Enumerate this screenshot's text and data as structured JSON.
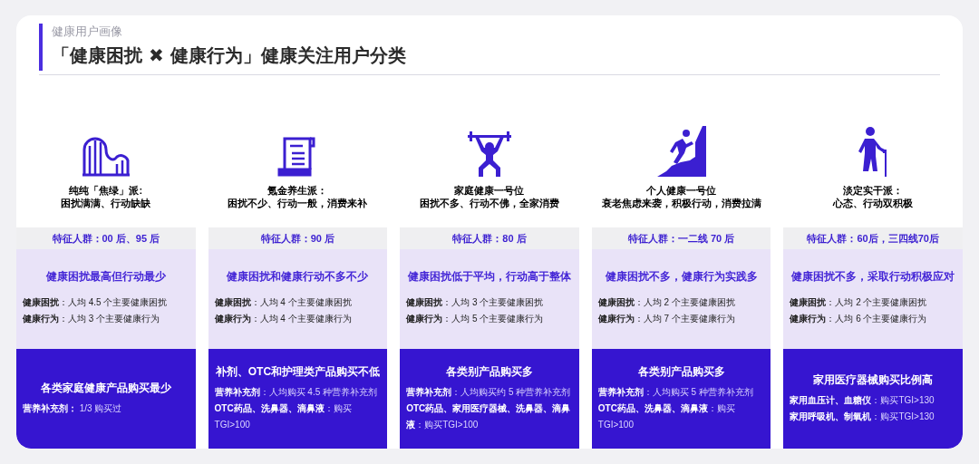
{
  "header": {
    "section": "健康用户画像",
    "title": "「健康困扰 ✖ 健康行为」健康关注用户分类"
  },
  "columns": [
    {
      "kind": "roller_coaster",
      "name": "纯纯「焦绿」派:",
      "tagline": "困扰满满、行动缺缺",
      "group": "特征人群：00 后、95 后",
      "summary": "健康困扰最高但行动最少",
      "stats": [
        {
          "label": "健康困扰",
          "text": "：人均 4.5 个主要健康困扰"
        },
        {
          "label": "健康行为",
          "text": "：人均 3 个主要健康行为"
        }
      ],
      "purchase_title": "各类家庭健康产品购买最少",
      "purchases": [
        {
          "label": "营养补充剂：",
          "text": " 1/3 购买过"
        }
      ]
    },
    {
      "kind": "scroll",
      "name": "氪金养生派：",
      "tagline": "困扰不少、行动一般，消费来补",
      "group": "特征人群：90 后",
      "summary": "健康困扰和健康行动不多不少",
      "stats": [
        {
          "label": "健康困扰",
          "text": "：人均 4 个主要健康困扰"
        },
        {
          "label": "健康行为",
          "text": "：人均 4 个主要健康行为"
        }
      ],
      "purchase_title": "补剂、OTC和护理类产品购买不低",
      "purchases": [
        {
          "label": "营养补充剂",
          "text": "：人均购买 4.5 种营养补充剂"
        },
        {
          "label": "OTC药品、洗鼻器、滴鼻液",
          "text": "：购买 TGI>100"
        }
      ]
    },
    {
      "kind": "weightlifter",
      "name": "家庭健康一号位",
      "tagline": "困扰不多、行动不佛，全家消费",
      "group": "特征人群：80 后",
      "summary": "健康困扰低于平均，行动高于整体",
      "stats": [
        {
          "label": "健康困扰",
          "text": "：人均 3 个主要健康困扰"
        },
        {
          "label": "健康行为",
          "text": "：人均 5 个主要健康行为"
        }
      ],
      "purchase_title": "各类别产品购买多",
      "purchases": [
        {
          "label": "营养补充剂",
          "text": "：人均购买约 5 种营养补充剂"
        },
        {
          "label": "OTC药品、家用医疗器械、洗鼻器、滴鼻液",
          "text": "：购买TGI>100"
        }
      ]
    },
    {
      "kind": "climber",
      "name": "个人健康一号位",
      "tagline": "衰老焦虑来袭，积极行动，消费拉满",
      "group": "特征人群：一二线 70 后",
      "summary": "健康困扰不多，健康行为实践多",
      "stats": [
        {
          "label": "健康困扰",
          "text": "：人均 2 个主要健康困扰"
        },
        {
          "label": "健康行为",
          "text": "：人均 7 个主要健康行为"
        }
      ],
      "purchase_title": "各类别产品购买多",
      "purchases": [
        {
          "label": "营养补充剂",
          "text": "：人均购买 5 种营养补充剂"
        },
        {
          "label": "OTC药品、洗鼻器、滴鼻液",
          "text": "：购买 TGI>100"
        }
      ]
    },
    {
      "kind": "elder",
      "name": "淡定实干派：",
      "tagline": "心态、行动双积极",
      "group": "特征人群：60后，三四线70后",
      "summary": "健康困扰不多，采取行动积极应对",
      "stats": [
        {
          "label": "健康困扰",
          "text": "：人均 2 个主要健康困扰"
        },
        {
          "label": "健康行为",
          "text": "：人均 6 个主要健康行为"
        }
      ],
      "purchase_title": "家用医疗器械购买比例高",
      "purchases": [
        {
          "label": "家用血压计、血糖仪",
          "text": "：购买TGI>130"
        },
        {
          "label": "家用呼吸机、制氧机",
          "text": "：购买TGI>130"
        }
      ]
    }
  ]
}
